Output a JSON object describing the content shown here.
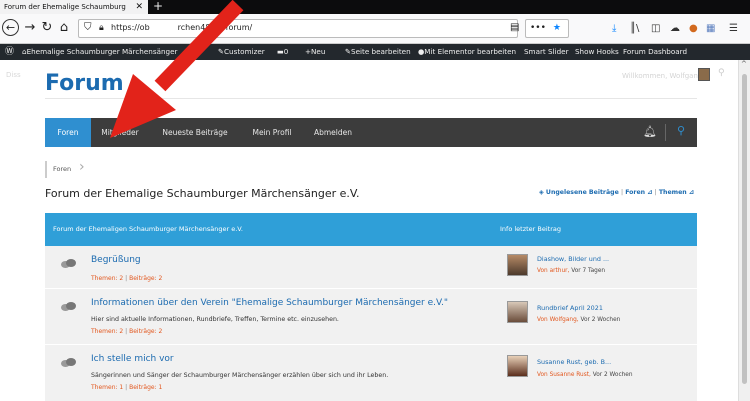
{
  "browser": {
    "tab_title": "Forum der Ehemalige Schaumburg",
    "tab_close": "✕",
    "new_tab": "+",
    "url_visible_start": "https://ob",
    "url_visible_end": "rchen48.de/forum/",
    "menu_dots": "•••"
  },
  "adminbar": {
    "site_name": "Ehemalige Schaumburger Märchensänger",
    "customizer": "Customizer",
    "comments_count": "0",
    "new": "Neu",
    "edit_page": "Seite bearbeiten",
    "elementor": "Mit Elementor bearbeiten",
    "smart_slider": "Smart Slider",
    "show_hooks": "Show Hooks",
    "forum_dashboard": "Forum Dashboard"
  },
  "page": {
    "ghost_left": "Diss",
    "ghost_right": "Willkommen, Wolfgang",
    "title": "Forum"
  },
  "nav": {
    "items": [
      "Foren",
      "Mitglieder",
      "Neueste Beiträge",
      "Mein Profil",
      "Abmelden"
    ],
    "active": "Foren"
  },
  "breadcrumb": {
    "item": "Foren"
  },
  "section": {
    "title": "Forum der Ehemalige Schaumburger Märchensänger e.V.",
    "links": {
      "unread": "Ungelesene Beiträge",
      "separator": "|",
      "forums": "Foren",
      "topics": "Themen"
    }
  },
  "table": {
    "header_left": "Forum der Ehemaligen Schaumburger Märchensänger e.V.",
    "header_right": "Info letzter Beitrag"
  },
  "forums": [
    {
      "title": "Begrüßung",
      "desc": "",
      "meta_topics": "Themen: 2",
      "meta_sep": "|",
      "meta_posts": "Beiträge: 2",
      "last_title": "Diashow, Bilder und ...",
      "last_by": "Von arthur,",
      "last_when": "Vor 7 Tagen"
    },
    {
      "title": "Informationen über den Verein \"Ehemalige Schaumburger Märchensänger e.V.\"",
      "desc": "Hier sind aktuelle Informationen, Rundbriefe, Treffen, Termine etc. einzusehen.",
      "meta_topics": "Themen: 2",
      "meta_sep": "|",
      "meta_posts": "Beiträge: 2",
      "last_title": "Rundbrief April 2021",
      "last_by": "Von Wolfgang,",
      "last_when": "Vor 2 Wochen"
    },
    {
      "title": "Ich stelle mich vor",
      "desc": "Sängerinnen und Sänger der Schaumburger Märchensänger erzählen über sich und ihr Leben.",
      "meta_topics": "Themen: 1",
      "meta_sep": "|",
      "meta_posts": "Beiträge: 1",
      "last_title": "Susanne Rust, geb. B...",
      "last_by": "Von Susanne Rust,",
      "last_when": "Vor 2 Wochen"
    }
  ],
  "icons": [
    "back-icon",
    "forward-icon",
    "reload-icon",
    "home-icon",
    "shield-icon",
    "lock-icon",
    "reader-icon",
    "star-icon",
    "download-icon",
    "library-icon",
    "sidebar-icon",
    "extension-icon",
    "menu-icon",
    "wordpress-icon",
    "bell-icon",
    "search-icon",
    "chat-bubbles-icon",
    "rss-icon"
  ],
  "colors": {
    "accent": "#2f9fd8",
    "link": "#1c6bb0",
    "meta": "#e2571e",
    "nav_bg": "#3c3c3c",
    "annotation": "#e2231a"
  }
}
